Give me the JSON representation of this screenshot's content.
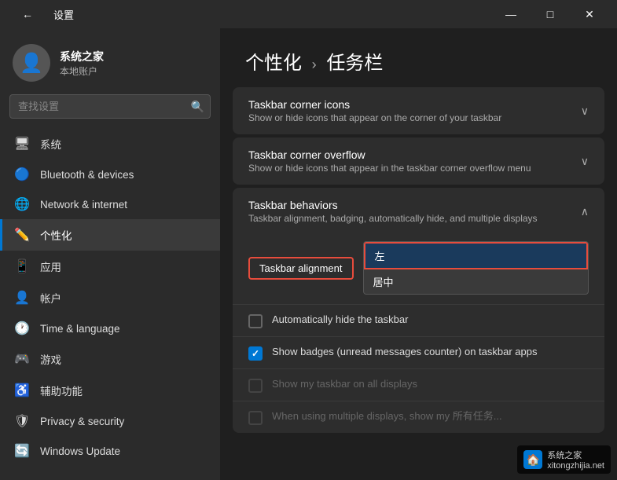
{
  "titlebar": {
    "back_icon": "←",
    "title": "设置",
    "btn_minimize": "—",
    "btn_maximize": "□",
    "btn_close": "✕"
  },
  "user": {
    "name": "系统之家",
    "subtitle": "本地账户"
  },
  "search": {
    "placeholder": "查找设置"
  },
  "nav": {
    "items": [
      {
        "id": "system",
        "icon": "🖥",
        "label": "系统"
      },
      {
        "id": "bluetooth",
        "icon": "🔵",
        "label": "Bluetooth & devices"
      },
      {
        "id": "network",
        "icon": "🌐",
        "label": "Network & internet"
      },
      {
        "id": "personalization",
        "icon": "✏️",
        "label": "个性化",
        "active": true
      },
      {
        "id": "apps",
        "icon": "📱",
        "label": "应用"
      },
      {
        "id": "accounts",
        "icon": "👤",
        "label": "帐户"
      },
      {
        "id": "time",
        "icon": "🕐",
        "label": "Time & language"
      },
      {
        "id": "gaming",
        "icon": "🎮",
        "label": "游戏"
      },
      {
        "id": "accessibility",
        "icon": "♿",
        "label": "辅助功能"
      },
      {
        "id": "privacy",
        "icon": "🛡",
        "label": "Privacy & security"
      },
      {
        "id": "update",
        "icon": "🔄",
        "label": "Windows Update"
      }
    ]
  },
  "page": {
    "breadcrumb_part1": "个性化",
    "breadcrumb_arrow": "›",
    "breadcrumb_part2": "任务栏"
  },
  "cards": {
    "corner_icons": {
      "title": "Taskbar corner icons",
      "subtitle": "Show or hide icons that appear on the corner of your taskbar",
      "chevron": "∨"
    },
    "corner_overflow": {
      "title": "Taskbar corner overflow",
      "subtitle": "Show or hide icons that appear in the taskbar corner overflow menu",
      "chevron": "∨"
    },
    "behaviors": {
      "title": "Taskbar behaviors",
      "subtitle": "Taskbar alignment, badging, automatically hide, and multiple displays",
      "chevron": "∧",
      "alignment_label": "Taskbar alignment",
      "current_option": "左",
      "options": [
        {
          "value": "left",
          "label": "左",
          "selected": true
        },
        {
          "value": "center",
          "label": "居中",
          "selected": false
        }
      ],
      "checkboxes": [
        {
          "id": "autohide",
          "label": "Automatically hide the taskbar",
          "checked": false,
          "dimmed": false
        },
        {
          "id": "badges",
          "label": "Show badges (unread messages counter) on taskbar apps",
          "checked": true,
          "dimmed": false
        },
        {
          "id": "all_displays",
          "label": "Show my taskbar on all displays",
          "checked": false,
          "dimmed": true
        },
        {
          "id": "multiple_displays",
          "label": "When using multiple displays, show my",
          "suffix": "所有任务...",
          "checked": false,
          "dimmed": true
        }
      ]
    }
  },
  "watermark": {
    "logo": "🏠",
    "text": "系统之家",
    "url": "xitongzhijia.net"
  }
}
